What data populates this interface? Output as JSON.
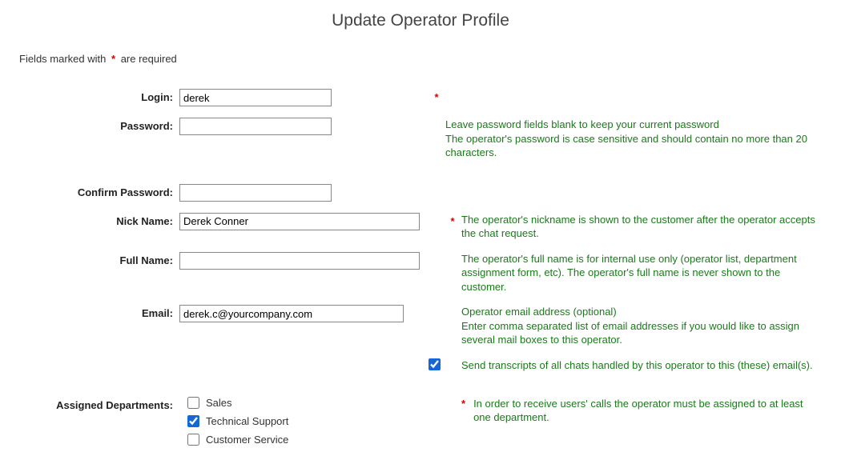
{
  "title": "Update Operator Profile",
  "requiredHint": {
    "pre": "Fields marked with",
    "post": "are required"
  },
  "labels": {
    "login": "Login:",
    "password": "Password:",
    "confirmPassword": "Confirm Password:",
    "nickName": "Nick Name:",
    "fullName": "Full Name:",
    "email": "Email:",
    "assignedDepartments": "Assigned Departments:"
  },
  "values": {
    "login": "derek",
    "password": "",
    "confirmPassword": "",
    "nickName": "Derek Conner",
    "fullName": "",
    "email": "derek.c@yourcompany.com",
    "sendTranscripts": true
  },
  "help": {
    "passwordLine1": "Leave password fields blank to keep your current password",
    "passwordLine2": "The operator's password is case sensitive and should contain no more than 20 characters.",
    "nickName": "The operator's nickname is shown to the customer after the operator accepts the chat request.",
    "fullName": "The operator's full name is for internal use only (operator list, department assignment form, etc). The operator's full name is never shown to the customer.",
    "emailLine1": "Operator email address (optional)",
    "emailLine2": "Enter comma separated list of email addresses if you would like to assign several mail boxes to this operator.",
    "sendTranscripts": "Send transcripts of all chats handled by this operator to this (these) email(s).",
    "departments": "In order to receive users' calls the operator must be assigned to at least one department."
  },
  "departments": [
    {
      "label": "Sales",
      "checked": false
    },
    {
      "label": "Technical Support",
      "checked": true
    },
    {
      "label": "Customer Service",
      "checked": false
    }
  ]
}
